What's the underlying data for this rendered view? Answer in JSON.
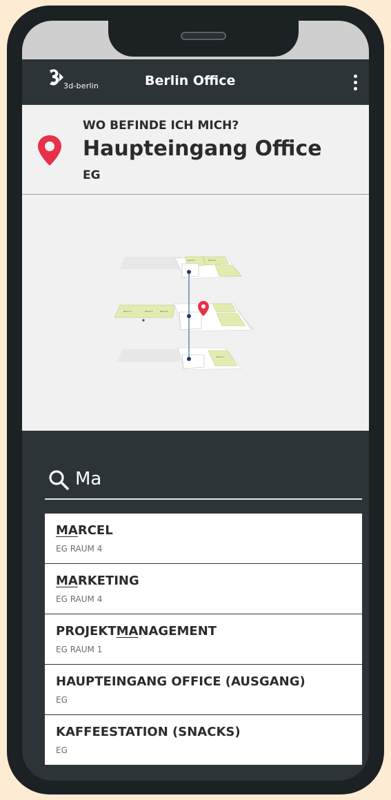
{
  "app": {
    "logo_text": "3d-berlin",
    "title": "Berlin Office"
  },
  "location": {
    "question": "WO BEFINDE ICH MICH?",
    "name": "Haupteingang Office",
    "floor": "EG"
  },
  "colors": {
    "accent": "#e63148",
    "dark": "#2c3437",
    "light": "#f1f1f1",
    "room": "#e3ecb0"
  },
  "search": {
    "value": "Ma",
    "icon": "search-icon"
  },
  "results": [
    {
      "prefix": "",
      "match": "MA",
      "suffix": "RCEL",
      "sub": "EG RAUM 4"
    },
    {
      "prefix": "",
      "match": "MA",
      "suffix": "RKETING",
      "sub": "EG RAUM 4"
    },
    {
      "prefix": "PROJEKT",
      "match": "MA",
      "suffix": "NAGEMENT",
      "sub": "EG RAUM 1"
    },
    {
      "prefix": "HAUPTEINGANG OFFICE (AUSGANG)",
      "match": "",
      "suffix": "",
      "sub": "EG"
    },
    {
      "prefix": "KAFFEESTATION (SNACKS)",
      "match": "",
      "suffix": "",
      "sub": "EG"
    }
  ]
}
